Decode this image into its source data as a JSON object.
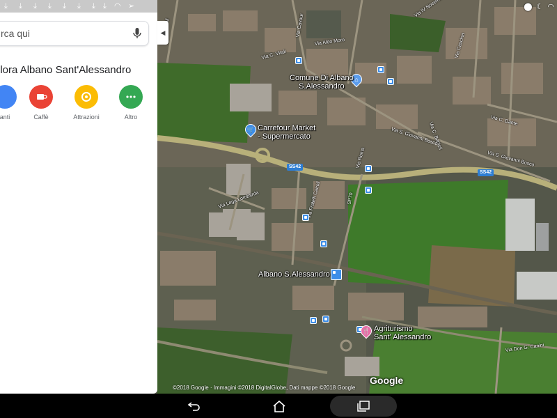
{
  "search": {
    "placeholder": "rca qui"
  },
  "explore": {
    "title": "plora Albano Sant'Alessandro",
    "categories": [
      {
        "label": "anti",
        "icon": "restaurant-icon",
        "color": "#4285f4"
      },
      {
        "label": "Caffè",
        "icon": "coffee-icon",
        "color": "#ea4335"
      },
      {
        "label": "Attrazioni",
        "icon": "attractions-icon",
        "color": "#fbbc04"
      },
      {
        "label": "Altro",
        "icon": "more-icon",
        "color": "#34a853"
      }
    ]
  },
  "map": {
    "places": {
      "comune": "Comune Di Albano\nS.Alessandro",
      "carrefour": "Carrefour Market\n- Supermercato",
      "station": "Albano S.Alessandro",
      "agriturismo": "Agriturismo\nSant' Alessandro"
    },
    "streets": {
      "via_c_vitali_1": "Via C. Vitali",
      "via_c_vitali_2": "Via C. Vitali",
      "via_aldo_moro": "Via Aldo Moro",
      "via_cavour": "Via Cavour",
      "via_iv_novembre": "Via IV Novembre",
      "via_cascina": "Via Cascina",
      "via_cesare_battisti": "Via C. Battisti",
      "via_s_giovanni_bosco_1": "Via S. Giovanni Bosco",
      "via_s_giovanni_bosco_2": "Via S. Giovanni Bosco",
      "via_c_dante": "Via C. Dante",
      "via_roma": "Via Roma",
      "via_lega_lombarda": "Via Lega Lombarda",
      "via_fratelli_cairoli": "Via Fratelli Cairoli",
      "sp70": "SP70",
      "via_don_g_canini": "Via Don G. Canini"
    },
    "shields": {
      "ss42_a": "SS42",
      "ss42_b": "SS42"
    },
    "copyright": "©2018 Google · Immagini ©2018 DigitalGlobe, Dati mappe ©2018 Google",
    "logo": "Google"
  },
  "navbar": {
    "back": "back-icon",
    "home": "home-icon",
    "recents": "recents-icon"
  }
}
